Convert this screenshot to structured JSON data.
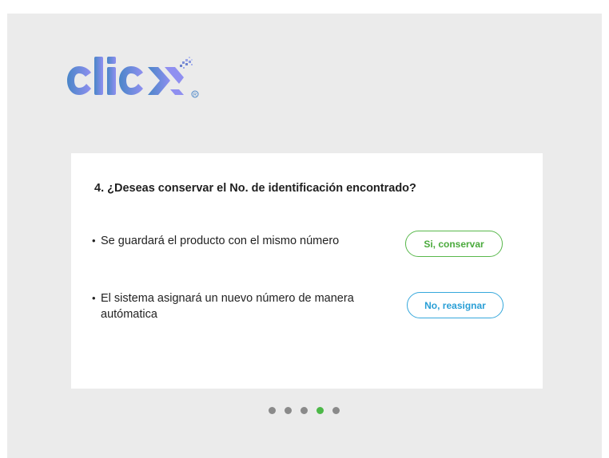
{
  "logo": {
    "text": "click",
    "mark": "®",
    "colors": [
      "#4a86c8",
      "#8f8ff0"
    ]
  },
  "card": {
    "question": "4. ¿Deseas conservar el No. de identificación encontrado?",
    "options": [
      {
        "text": "Se guardará el producto con el mismo número",
        "button": "Si, conservar",
        "color": "#59b84c"
      },
      {
        "text": "El sistema asignará un nuevo número de manera autómatica",
        "button": "No, reasignar",
        "color": "#36a8dc"
      }
    ]
  },
  "pagination": {
    "total": 5,
    "active_index": 3,
    "active_color": "#4cb848",
    "inactive_color": "#8a8a8a"
  }
}
